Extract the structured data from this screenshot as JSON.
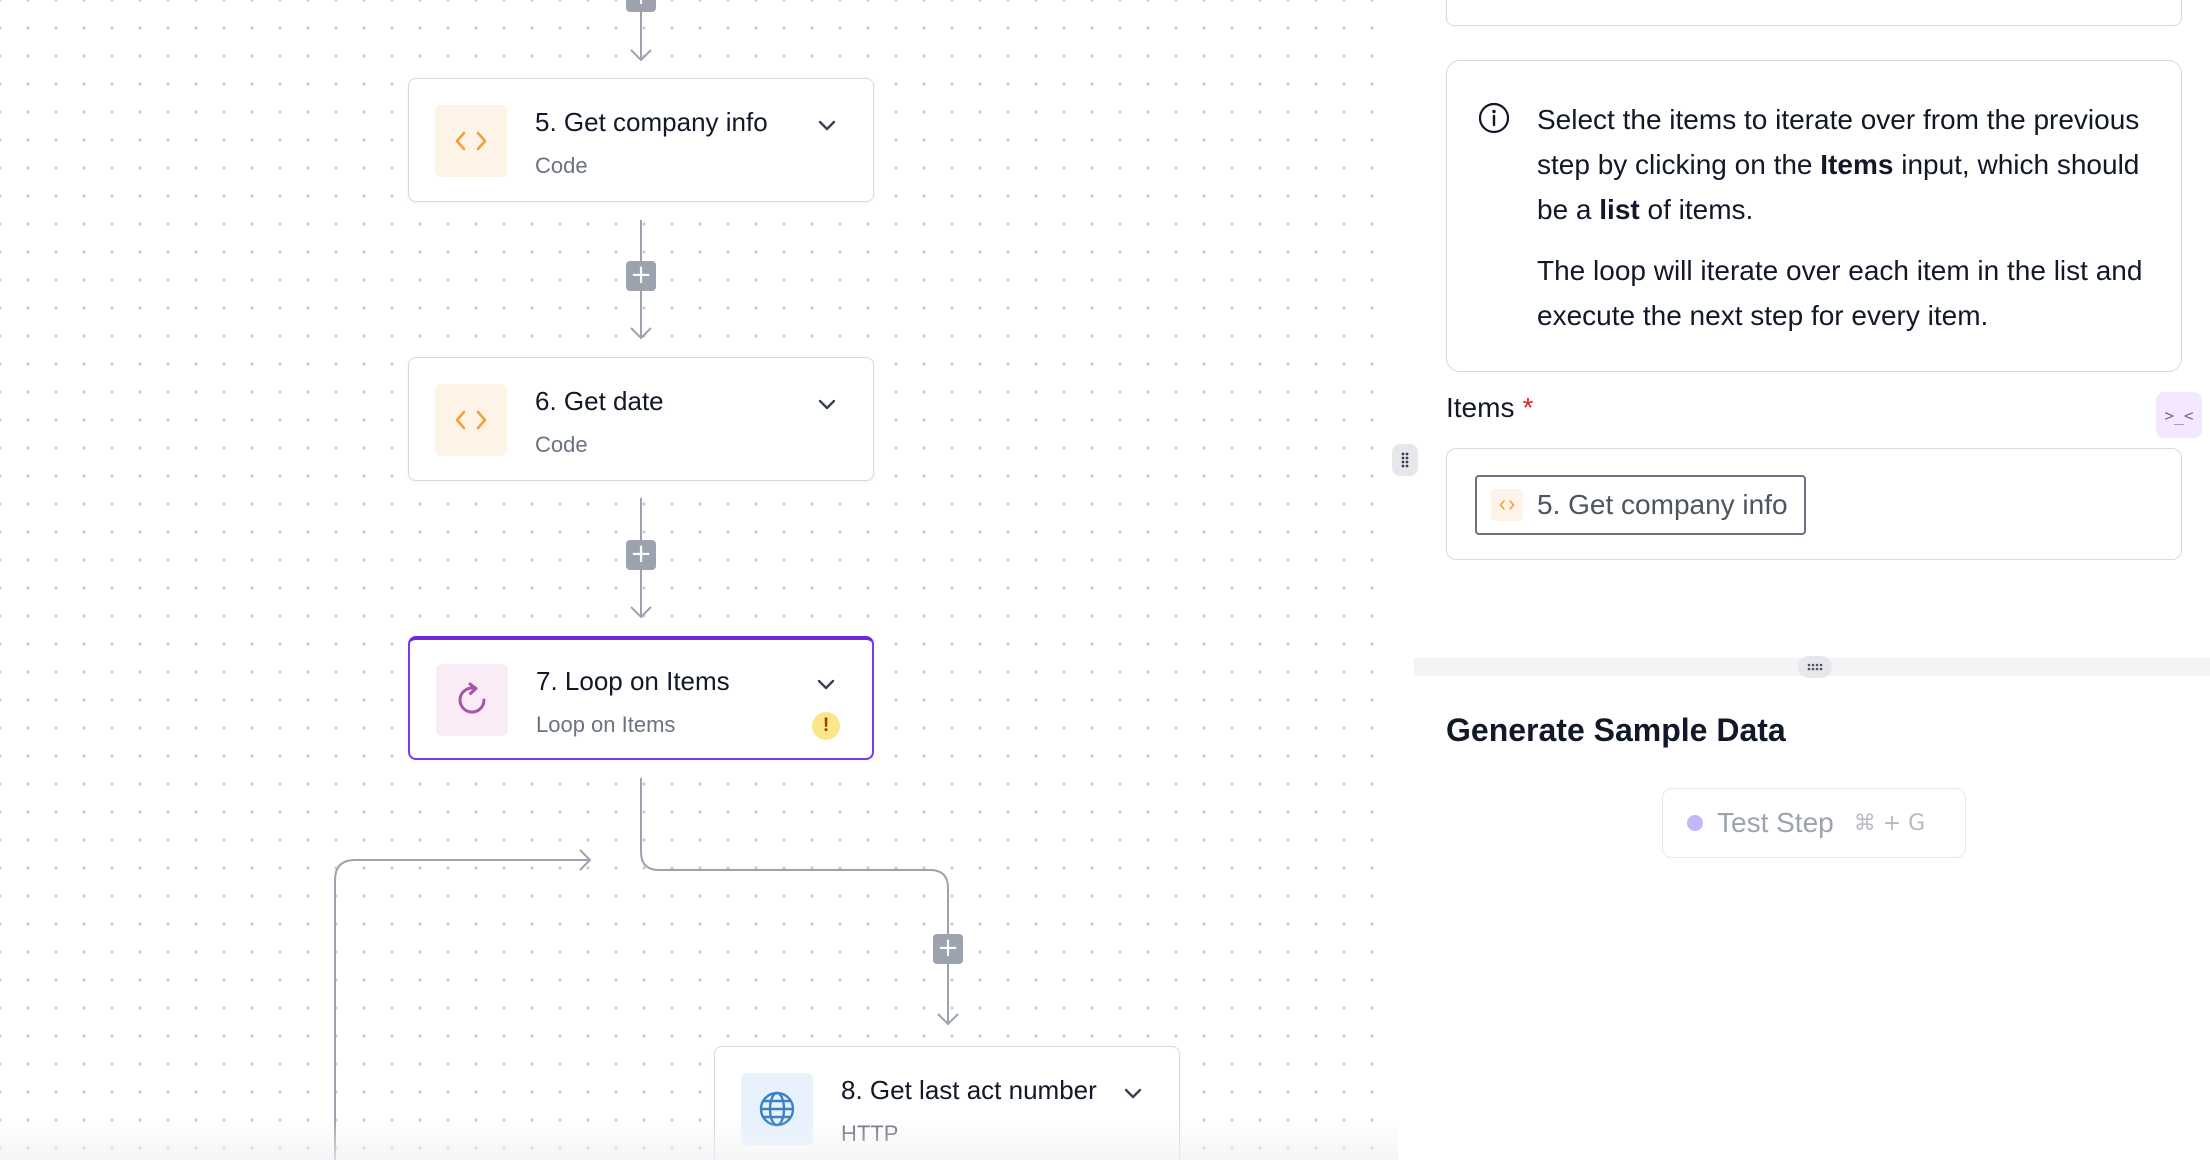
{
  "canvas": {
    "steps": [
      {
        "title": "5. Get company info",
        "subtitle": "Code",
        "icon": "code-icon"
      },
      {
        "title": "6. Get date",
        "subtitle": "Code",
        "icon": "code-icon"
      },
      {
        "title": "7. Loop on Items",
        "subtitle": "Loop on Items",
        "icon": "loop-icon",
        "warning": "!"
      },
      {
        "title": "8. Get last act number",
        "subtitle": "HTTP",
        "icon": "globe-icon"
      }
    ],
    "add_button_symbol": "+"
  },
  "panel": {
    "info": {
      "p1_a": "Select the items to iterate over from the previous step by clicking on the ",
      "p1_b": "Items",
      "p1_c": " input, which should be a ",
      "p1_d": "list",
      "p1_e": " of items.",
      "p2": "The loop will iterate over each item in the list and execute the next step for every item."
    },
    "items_label": "Items",
    "required_mark": "*",
    "items_chip": "5. Get company info",
    "side_tab_symbol": ">_<",
    "generate_title": "Generate Sample Data",
    "test_button": {
      "label": "Test Step",
      "shortcut": "⌘ + G"
    }
  },
  "colors": {
    "accent": "#6d28d9",
    "code_icon": "#f0a13a",
    "loop_icon": "#a855a8",
    "http_icon": "#3b82c4"
  }
}
